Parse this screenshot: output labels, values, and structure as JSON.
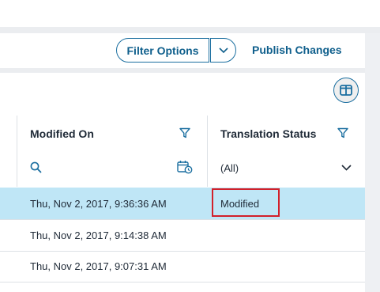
{
  "toolbar": {
    "filter_options_label": "Filter Options",
    "publish_changes_label": "Publish Changes",
    "split_icon": "chevron-down-icon"
  },
  "grid": {
    "column_picker_icon": "columns-icon",
    "columns": {
      "modified_on": {
        "header": "Modified On",
        "filter_icon": "funnel-icon",
        "search_icon": "search-icon",
        "date_icon": "calendar-clock-icon"
      },
      "translation_status": {
        "header": "Translation Status",
        "filter_icon": "funnel-icon",
        "filter_value": "(All)",
        "dropdown_icon": "chevron-down-icon"
      }
    },
    "rows": [
      {
        "modified_on": "Thu, Nov 2, 2017, 9:36:36 AM",
        "translation_status": "Modified",
        "selected": true
      },
      {
        "modified_on": "Thu, Nov 2, 2017, 9:14:38 AM",
        "translation_status": "",
        "selected": false
      },
      {
        "modified_on": "Thu, Nov 2, 2017, 9:07:31 AM",
        "translation_status": "",
        "selected": false
      }
    ]
  },
  "colors": {
    "accent": "#0f5f8c",
    "selected_row": "#bfe6f6",
    "highlight_border": "#d2202a",
    "band": "#ebedf0"
  }
}
